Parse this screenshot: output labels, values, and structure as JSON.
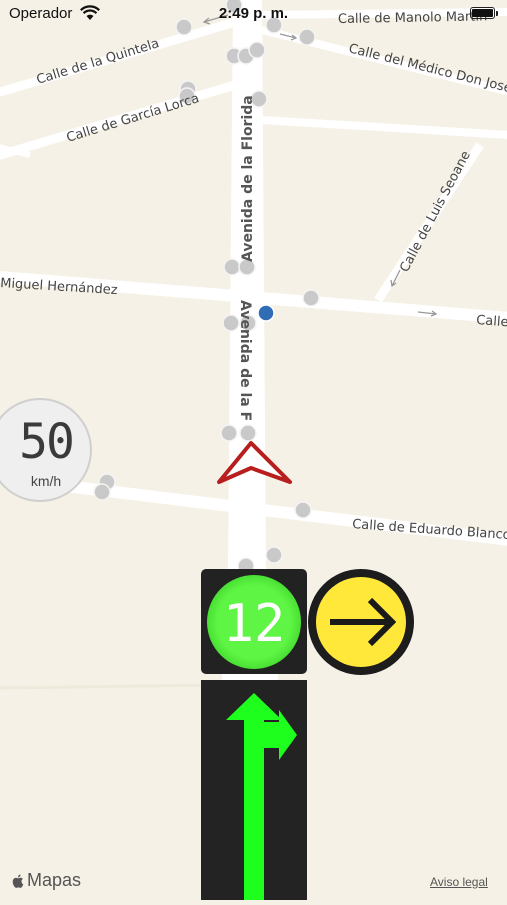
{
  "status_bar": {
    "carrier": "Operador",
    "time": "2:49 p. m.",
    "wifi_icon": "wifi-icon",
    "battery_icon": "battery-icon"
  },
  "map": {
    "streets": {
      "manolo_martin": "Calle de Manolo Martín",
      "quintela": "Calle de la Quintela",
      "garcia_lorca": "Calle de García Lorca",
      "medico": "Calle del Médico Don José M",
      "avenida_north": "Avenida de la Florida",
      "luis_seoane": "Calle de Luis Seoane",
      "miguel_hernandez": "Miguel Hernández",
      "calle_east": "Calle",
      "avenida_south": "Avenida de la F",
      "eduardo_blanco": "Calle de Eduardo Blanco"
    },
    "user_location_color": "#2f6db5",
    "heading_marker_color": "#b81e1e"
  },
  "speed_limit": {
    "value": "50",
    "unit": "km/h"
  },
  "traffic_light": {
    "countdown": "12",
    "countdown_color": "#5ff544",
    "direction_color": "#ffe83a",
    "direction_icon": "arrow-right-icon",
    "lane_icon": "lane-straight-right-icon",
    "lane_color": "#1eff1e"
  },
  "footer": {
    "maps_brand": "Mapas",
    "legal_link": "Aviso legal"
  }
}
